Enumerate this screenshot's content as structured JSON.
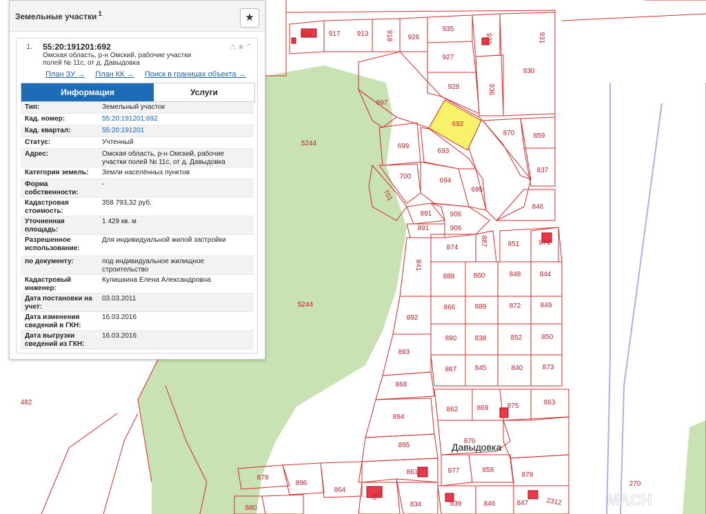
{
  "panel": {
    "title": "Земельные участки",
    "count": "1",
    "star_icon": "★",
    "result": {
      "number": "1.",
      "cadastral_id": "55:20:191201:692",
      "address": "Омская область, р-н Омский, рабочие участки полей № 11с, от д. Давыдовка",
      "icons": "⚠★⌃",
      "links": [
        "План ЗУ →",
        "План КК →",
        "Поиск в границах объекта →"
      ]
    },
    "tabs": {
      "info": "Информация",
      "services": "Услуги"
    },
    "rows": [
      {
        "key": "Тип:",
        "value": "Земельный участок"
      },
      {
        "key": "Кад. номер:",
        "value": "55:20:191201:692"
      },
      {
        "key": "Кад. квартал:",
        "value": "55:20:191201"
      },
      {
        "key": "Статус:",
        "value": "Учтенный"
      },
      {
        "key": "Адрес:",
        "value": "Омская область, р-н Омский, рабочие участки полей № 11с, от д. Давыдовка"
      },
      {
        "key": "Категория земель:",
        "value": "Земли населённых пунктов"
      },
      {
        "key": "Форма собственности:",
        "value": "-"
      },
      {
        "key": "Кадастровая стоимость:",
        "value": "358 793,32 руб."
      },
      {
        "key": "Уточненная площадь:",
        "value": "1 429 кв. м"
      },
      {
        "key": "Разрешенное использование:",
        "value": "Для индивидуальной жилой застройки"
      },
      {
        "key": "по документу:",
        "value": "под индивидуальное жилищное строительство"
      },
      {
        "key": "Кадастровый инженер:",
        "value": "Кулишкина Елена Александровна"
      },
      {
        "key": "Дата постановки на учет:",
        "value": "03.03.2011"
      },
      {
        "key": "Дата изменения сведений в ГКН:",
        "value": "16.03.2016"
      },
      {
        "key": "Дата выгрузки сведений из ГКН:",
        "value": "16.03.2016"
      }
    ]
  },
  "map": {
    "village": "Давыдовка",
    "watermark": "МАСН",
    "colors": {
      "parcel_border": "#d42a2a",
      "forest": "#c8e2b4",
      "highlight": "#f7f26a",
      "road": "#b0b0e0"
    },
    "labels": [
      "934",
      "917",
      "913",
      "918",
      "926",
      "935",
      "929",
      "931",
      "927",
      "930",
      "928",
      "936",
      "697",
      "692",
      "870",
      "859",
      "699",
      "693",
      "5244",
      "837",
      "700",
      "694",
      "695",
      "701",
      "846",
      "891",
      "906",
      "891",
      "906",
      "874",
      "887",
      "851",
      "871",
      "841",
      "888",
      "860",
      "848",
      "844",
      "866",
      "889",
      "872",
      "849",
      "892",
      "890",
      "838",
      "852",
      "850",
      "893",
      "867",
      "845",
      "840",
      "873",
      "868",
      "862",
      "869",
      "875",
      "863",
      "894",
      "876",
      "895",
      "877",
      "858",
      "878",
      "861",
      "879",
      "896",
      "864",
      "897",
      "834",
      "839",
      "846",
      "847",
      "2312",
      "270",
      "880",
      "5244",
      "482"
    ]
  }
}
